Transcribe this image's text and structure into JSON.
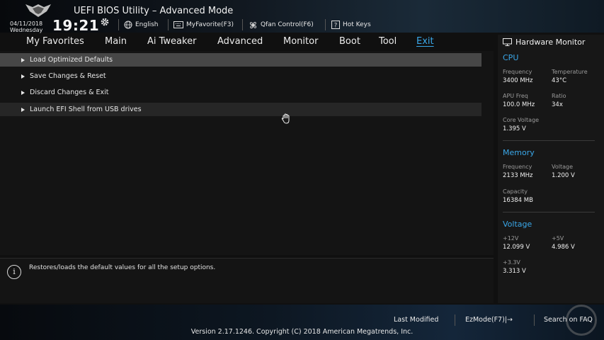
{
  "header": {
    "title": "UEFI BIOS Utility – Advanced Mode",
    "date": "04/11/2018",
    "weekday": "Wednesday",
    "time": "19:21",
    "buttons": [
      {
        "label": "English",
        "icon": "globe-icon"
      },
      {
        "label": "MyFavorite(F3)",
        "icon": "keyboard-icon"
      },
      {
        "label": "Qfan Control(F6)",
        "icon": "fan-icon"
      },
      {
        "label": "Hot Keys",
        "icon": "help-icon"
      }
    ]
  },
  "menu": {
    "items": [
      "My Favorites",
      "Main",
      "Ai Tweaker",
      "Advanced",
      "Monitor",
      "Boot",
      "Tool",
      "Exit"
    ],
    "active": "Exit"
  },
  "content": {
    "items": [
      "Load Optimized Defaults",
      "Save Changes & Reset",
      "Discard Changes & Exit",
      "Launch EFI Shell from USB drives"
    ]
  },
  "help": {
    "text": "Restores/loads the default values for all the setup options."
  },
  "hardware_monitor": {
    "title": "Hardware Monitor",
    "cpu": {
      "title": "CPU",
      "frequency_label": "Frequency",
      "frequency": "3400 MHz",
      "temperature_label": "Temperature",
      "temperature": "43°C",
      "apu_label": "APU Freq",
      "apu": "100.0 MHz",
      "ratio_label": "Ratio",
      "ratio": "34x",
      "core_voltage_label": "Core Voltage",
      "core_voltage": "1.395 V"
    },
    "memory": {
      "title": "Memory",
      "frequency_label": "Frequency",
      "frequency": "2133 MHz",
      "voltage_label": "Voltage",
      "voltage": "1.200 V",
      "capacity_label": "Capacity",
      "capacity": "16384 MB"
    },
    "voltage": {
      "title": "Voltage",
      "v12_label": "+12V",
      "v12": "12.099 V",
      "v5_label": "+5V",
      "v5": "4.986 V",
      "v33_label": "+3.3V",
      "v33": "3.313 V"
    }
  },
  "footer": {
    "last_modified": "Last Modified",
    "ezmode": "EzMode(F7)|→",
    "search": "Search on FAQ",
    "version": "Version 2.17.1246. Copyright (C) 2018 American Megatrends, Inc."
  },
  "colors": {
    "accent": "#3aa7e8",
    "selected_row": "#474747",
    "background": "#101010"
  }
}
